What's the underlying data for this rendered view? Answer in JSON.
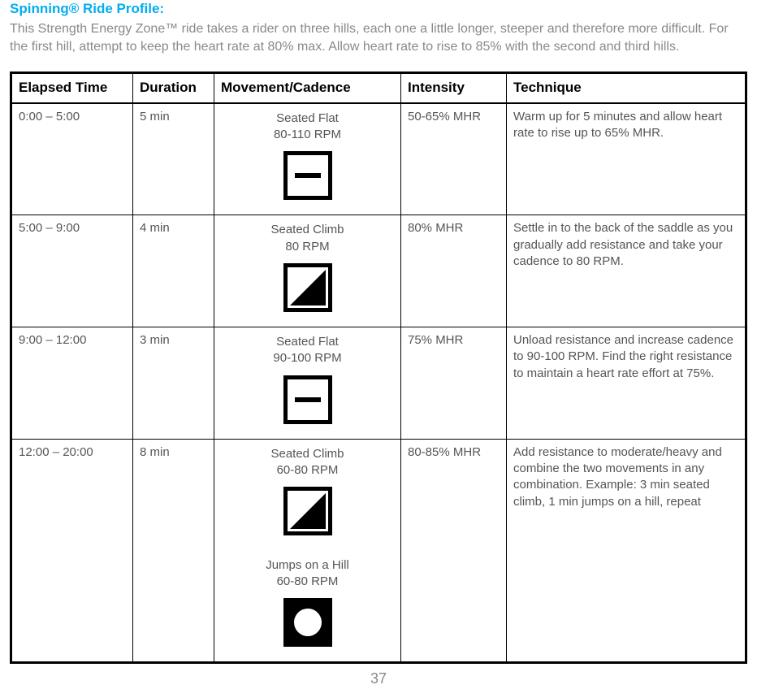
{
  "title": "Spinning® Ride Profile:",
  "description": "This Strength Energy Zone™ ride takes a rider on three hills, each one a little longer, steeper and therefore more difficult. For the first hill, attempt to keep the heart rate at 80% max. Allow heart rate to rise to 85% with the second and third hills.",
  "headers": {
    "elapsed": "Elapsed Time",
    "duration": "Duration",
    "movement": "Movement/Cadence",
    "intensity": "Intensity",
    "technique": "Technique"
  },
  "rows": [
    {
      "elapsed": "0:00 – 5:00",
      "duration": "5 min",
      "movements": [
        {
          "name": "Seated Flat",
          "rpm": "80-110 RPM",
          "icon": "flat"
        }
      ],
      "intensity": "50-65% MHR",
      "technique": "Warm up for 5 minutes and allow heart rate to rise up to 65% MHR."
    },
    {
      "elapsed": "5:00 – 9:00",
      "duration": "4 min",
      "movements": [
        {
          "name": "Seated Climb",
          "rpm": "80 RPM",
          "icon": "climb"
        }
      ],
      "intensity": "80% MHR",
      "technique": "Settle in to the back of the saddle as you gradually add resistance and take your cadence to 80 RPM."
    },
    {
      "elapsed": "9:00 – 12:00",
      "duration": "3 min",
      "movements": [
        {
          "name": "Seated Flat",
          "rpm": "90-100 RPM",
          "icon": "flat"
        }
      ],
      "intensity": "75% MHR",
      "technique": "Unload resistance and increase cadence to 90-100 RPM. Find the right resistance to maintain a heart rate effort at 75%."
    },
    {
      "elapsed": "12:00 – 20:00",
      "duration": "8 min",
      "movements": [
        {
          "name": "Seated Climb",
          "rpm": "60-80 RPM",
          "icon": "climb"
        },
        {
          "name": "Jumps on a Hill",
          "rpm": "60-80 RPM",
          "icon": "circle"
        }
      ],
      "intensity": "80-85% MHR",
      "technique": "Add resistance to moderate/heavy and combine the two movements in any combination. Example: 3 min seated climb, 1 min jumps on a hill, repeat"
    }
  ],
  "page_number": "37"
}
